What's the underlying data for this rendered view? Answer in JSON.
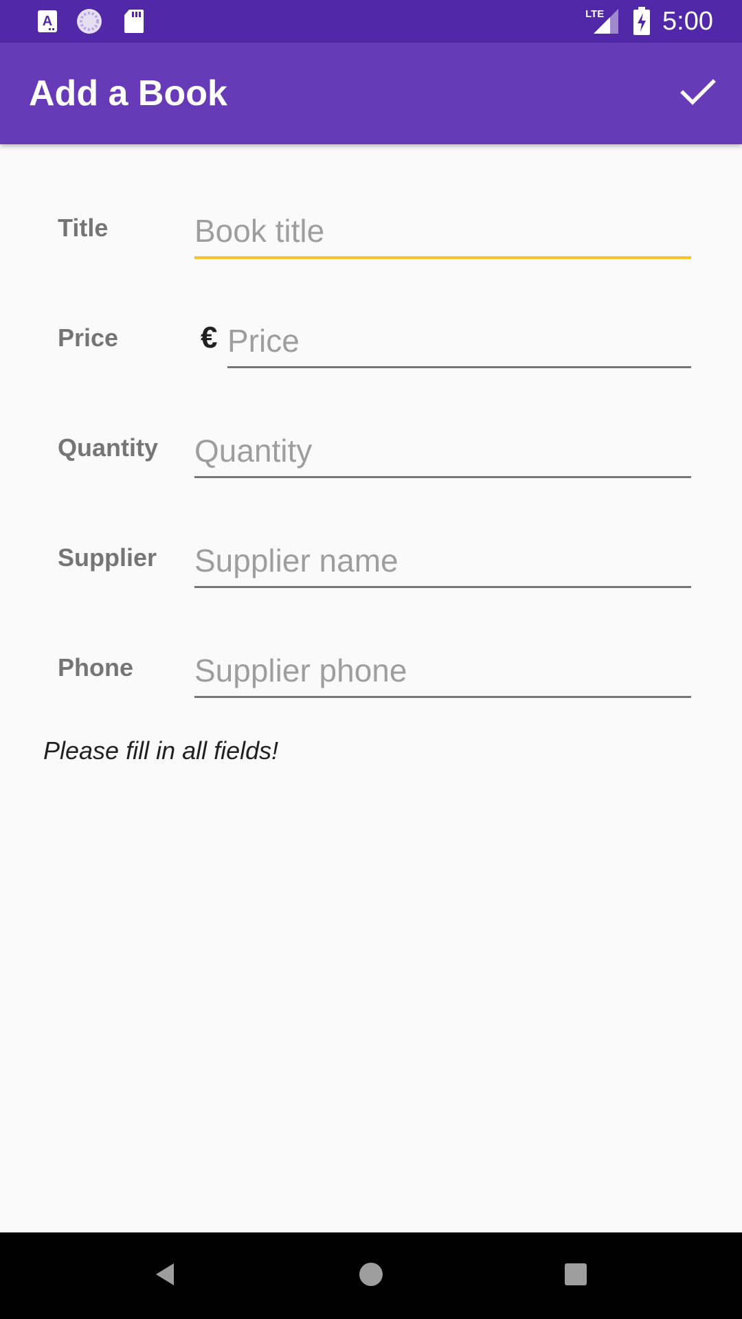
{
  "status_bar": {
    "time": "5:00",
    "notification_icons": [
      "a-badge-icon",
      "sync-circle-icon",
      "sd-card-icon"
    ],
    "network_label": "LTE",
    "color": "#5128a8"
  },
  "app_bar": {
    "title": "Add a Book",
    "save_icon": "check-icon",
    "color": "#673ab7"
  },
  "form": {
    "fields": [
      {
        "label": "Title",
        "placeholder": "Book title",
        "value": ""
      },
      {
        "label": "Price",
        "prefix": "€",
        "placeholder": "Price",
        "value": ""
      },
      {
        "label": "Quantity",
        "placeholder": "Quantity",
        "value": ""
      },
      {
        "label": "Supplier",
        "placeholder": "Supplier name",
        "value": ""
      },
      {
        "label": "Phone",
        "placeholder": "Supplier phone",
        "value": ""
      }
    ],
    "validation_message": "Please fill in all fields!",
    "focus_color": "#f7c325"
  },
  "nav_bar": {
    "buttons": [
      "back-icon",
      "home-icon",
      "recents-icon"
    ]
  }
}
